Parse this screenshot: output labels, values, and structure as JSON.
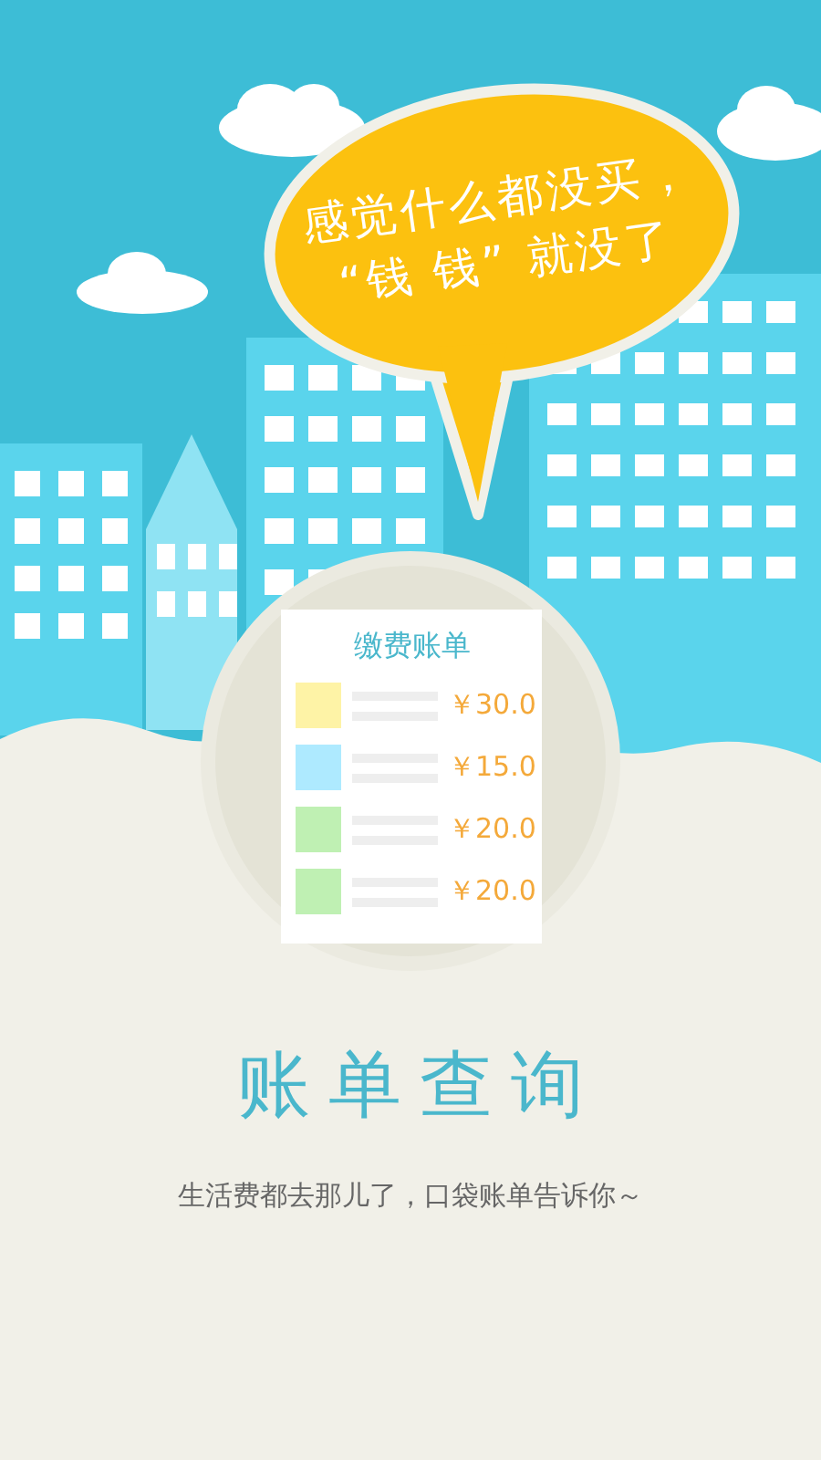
{
  "speech_bubble": {
    "lines": [
      "感觉什么都没买，",
      "“钱 钱” 就没了"
    ]
  },
  "bill_card": {
    "title": "缴费账单",
    "items": [
      {
        "color": "#fef3a6",
        "amount": "￥30.0"
      },
      {
        "color": "#aeeaff",
        "amount": "￥15.0"
      },
      {
        "color": "#bff0b3",
        "amount": "￥20.0"
      },
      {
        "color": "#bff0b3",
        "amount": "￥20.0"
      }
    ]
  },
  "title": "账单查询",
  "subtitle": "生活费都去那儿了，口袋账单告诉你～"
}
